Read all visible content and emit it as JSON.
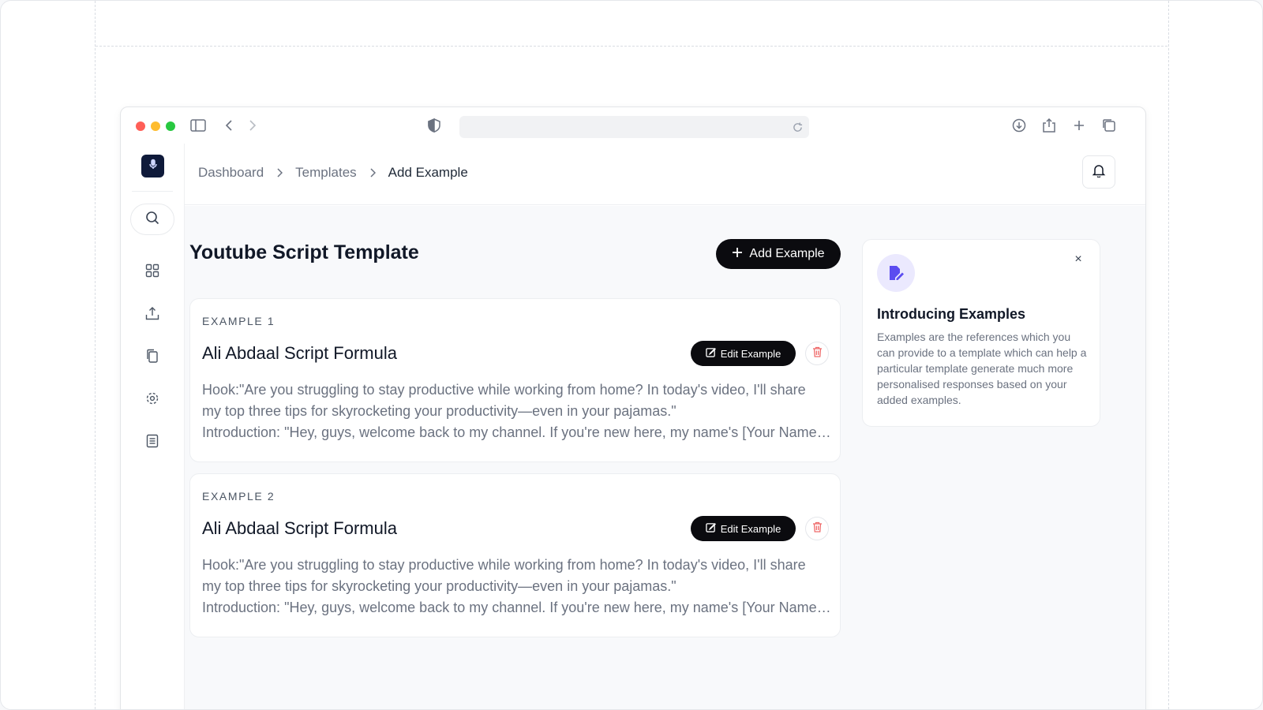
{
  "breadcrumb": {
    "items": [
      "Dashboard",
      "Templates",
      "Add Example"
    ]
  },
  "page": {
    "title": "Youtube Script Template",
    "add_button_label": "Add Example"
  },
  "examples": [
    {
      "label": "EXAMPLE 1",
      "title": "Ali Abdaal Script Formula",
      "edit_label": "Edit Example",
      "lines": [
        "Hook:\"Are you struggling to stay productive while working from home? In today's video, I'll share",
        "my top three tips for skyrocketing your productivity—even in your pajamas.\"",
        "Introduction: \"Hey, guys, welcome back to my channel. If you're new here, my name's [Your Name] and I make videos about productivity.\""
      ]
    },
    {
      "label": "EXAMPLE 2",
      "title": "Ali Abdaal Script Formula",
      "edit_label": "Edit Example",
      "lines": [
        "Hook:\"Are you struggling to stay productive while working from home? In today's video, I'll share",
        "my top three tips for skyrocketing your productivity—even in your pajamas.\"",
        "Introduction: \"Hey, guys, welcome back to my channel. If you're new here, my name's [Your Name] and I make videos about productivity.\""
      ]
    }
  ],
  "info_panel": {
    "title": "Introducing Examples",
    "description": "Examples are the references which you can provide to a template which can help a particular template generate much more personalised responses based on your added examples.",
    "close_glyph": "×"
  },
  "colors": {
    "traffic_red": "#ff5f57",
    "traffic_yellow": "#febc2e",
    "traffic_green": "#28c840",
    "accent_purple": "#5b4cf0",
    "delete_red": "#ef6b6b"
  },
  "icons": {
    "sidebar": [
      "search-icon",
      "grid-icon",
      "upload-icon",
      "copy-icon",
      "settings-icon",
      "document-icon"
    ],
    "browser": [
      "sidebar-toggle-icon",
      "back-icon",
      "forward-icon",
      "shield-icon",
      "reload-icon",
      "download-icon",
      "share-icon",
      "new-tab-icon",
      "tabs-icon"
    ]
  }
}
